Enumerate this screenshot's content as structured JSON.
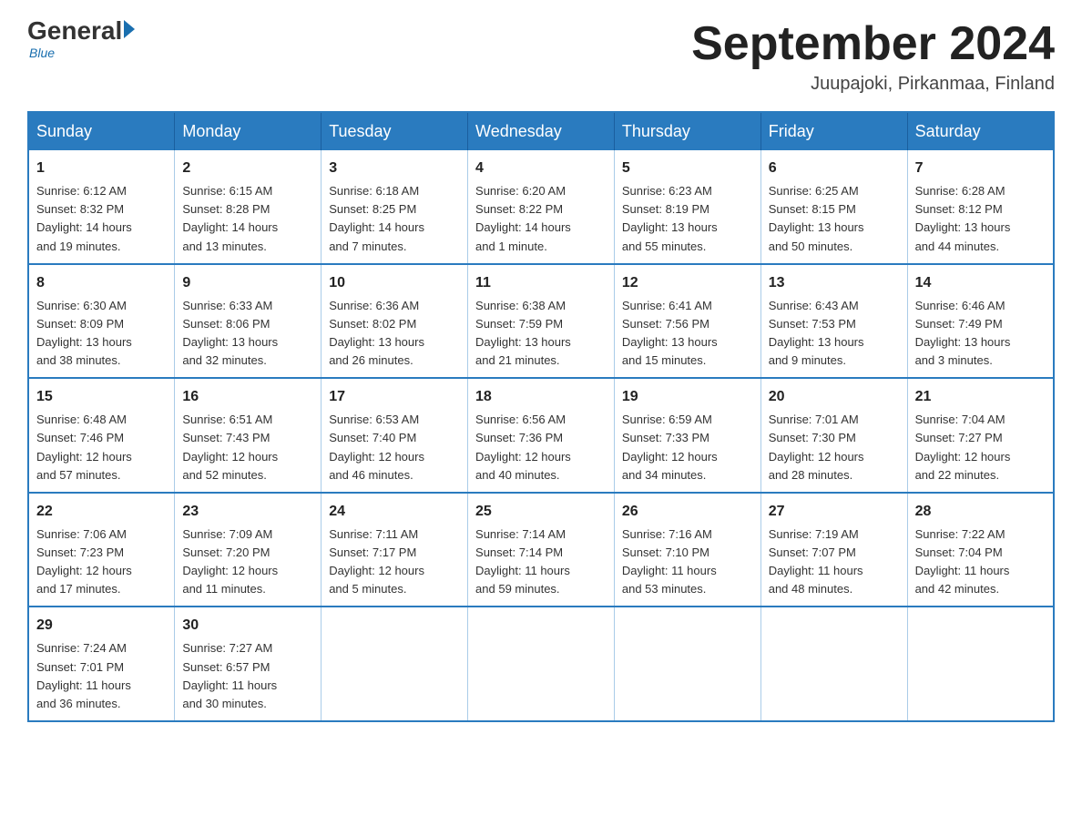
{
  "logo": {
    "general": "General",
    "blue": "Blue",
    "subtitle": "Blue"
  },
  "header": {
    "title": "September 2024",
    "location": "Juupajoki, Pirkanmaa, Finland"
  },
  "days_header": [
    "Sunday",
    "Monday",
    "Tuesday",
    "Wednesday",
    "Thursday",
    "Friday",
    "Saturday"
  ],
  "weeks": [
    [
      {
        "day": "1",
        "info": "Sunrise: 6:12 AM\nSunset: 8:32 PM\nDaylight: 14 hours\nand 19 minutes."
      },
      {
        "day": "2",
        "info": "Sunrise: 6:15 AM\nSunset: 8:28 PM\nDaylight: 14 hours\nand 13 minutes."
      },
      {
        "day": "3",
        "info": "Sunrise: 6:18 AM\nSunset: 8:25 PM\nDaylight: 14 hours\nand 7 minutes."
      },
      {
        "day": "4",
        "info": "Sunrise: 6:20 AM\nSunset: 8:22 PM\nDaylight: 14 hours\nand 1 minute."
      },
      {
        "day": "5",
        "info": "Sunrise: 6:23 AM\nSunset: 8:19 PM\nDaylight: 13 hours\nand 55 minutes."
      },
      {
        "day": "6",
        "info": "Sunrise: 6:25 AM\nSunset: 8:15 PM\nDaylight: 13 hours\nand 50 minutes."
      },
      {
        "day": "7",
        "info": "Sunrise: 6:28 AM\nSunset: 8:12 PM\nDaylight: 13 hours\nand 44 minutes."
      }
    ],
    [
      {
        "day": "8",
        "info": "Sunrise: 6:30 AM\nSunset: 8:09 PM\nDaylight: 13 hours\nand 38 minutes."
      },
      {
        "day": "9",
        "info": "Sunrise: 6:33 AM\nSunset: 8:06 PM\nDaylight: 13 hours\nand 32 minutes."
      },
      {
        "day": "10",
        "info": "Sunrise: 6:36 AM\nSunset: 8:02 PM\nDaylight: 13 hours\nand 26 minutes."
      },
      {
        "day": "11",
        "info": "Sunrise: 6:38 AM\nSunset: 7:59 PM\nDaylight: 13 hours\nand 21 minutes."
      },
      {
        "day": "12",
        "info": "Sunrise: 6:41 AM\nSunset: 7:56 PM\nDaylight: 13 hours\nand 15 minutes."
      },
      {
        "day": "13",
        "info": "Sunrise: 6:43 AM\nSunset: 7:53 PM\nDaylight: 13 hours\nand 9 minutes."
      },
      {
        "day": "14",
        "info": "Sunrise: 6:46 AM\nSunset: 7:49 PM\nDaylight: 13 hours\nand 3 minutes."
      }
    ],
    [
      {
        "day": "15",
        "info": "Sunrise: 6:48 AM\nSunset: 7:46 PM\nDaylight: 12 hours\nand 57 minutes."
      },
      {
        "day": "16",
        "info": "Sunrise: 6:51 AM\nSunset: 7:43 PM\nDaylight: 12 hours\nand 52 minutes."
      },
      {
        "day": "17",
        "info": "Sunrise: 6:53 AM\nSunset: 7:40 PM\nDaylight: 12 hours\nand 46 minutes."
      },
      {
        "day": "18",
        "info": "Sunrise: 6:56 AM\nSunset: 7:36 PM\nDaylight: 12 hours\nand 40 minutes."
      },
      {
        "day": "19",
        "info": "Sunrise: 6:59 AM\nSunset: 7:33 PM\nDaylight: 12 hours\nand 34 minutes."
      },
      {
        "day": "20",
        "info": "Sunrise: 7:01 AM\nSunset: 7:30 PM\nDaylight: 12 hours\nand 28 minutes."
      },
      {
        "day": "21",
        "info": "Sunrise: 7:04 AM\nSunset: 7:27 PM\nDaylight: 12 hours\nand 22 minutes."
      }
    ],
    [
      {
        "day": "22",
        "info": "Sunrise: 7:06 AM\nSunset: 7:23 PM\nDaylight: 12 hours\nand 17 minutes."
      },
      {
        "day": "23",
        "info": "Sunrise: 7:09 AM\nSunset: 7:20 PM\nDaylight: 12 hours\nand 11 minutes."
      },
      {
        "day": "24",
        "info": "Sunrise: 7:11 AM\nSunset: 7:17 PM\nDaylight: 12 hours\nand 5 minutes."
      },
      {
        "day": "25",
        "info": "Sunrise: 7:14 AM\nSunset: 7:14 PM\nDaylight: 11 hours\nand 59 minutes."
      },
      {
        "day": "26",
        "info": "Sunrise: 7:16 AM\nSunset: 7:10 PM\nDaylight: 11 hours\nand 53 minutes."
      },
      {
        "day": "27",
        "info": "Sunrise: 7:19 AM\nSunset: 7:07 PM\nDaylight: 11 hours\nand 48 minutes."
      },
      {
        "day": "28",
        "info": "Sunrise: 7:22 AM\nSunset: 7:04 PM\nDaylight: 11 hours\nand 42 minutes."
      }
    ],
    [
      {
        "day": "29",
        "info": "Sunrise: 7:24 AM\nSunset: 7:01 PM\nDaylight: 11 hours\nand 36 minutes."
      },
      {
        "day": "30",
        "info": "Sunrise: 7:27 AM\nSunset: 6:57 PM\nDaylight: 11 hours\nand 30 minutes."
      },
      {
        "day": "",
        "info": ""
      },
      {
        "day": "",
        "info": ""
      },
      {
        "day": "",
        "info": ""
      },
      {
        "day": "",
        "info": ""
      },
      {
        "day": "",
        "info": ""
      }
    ]
  ]
}
